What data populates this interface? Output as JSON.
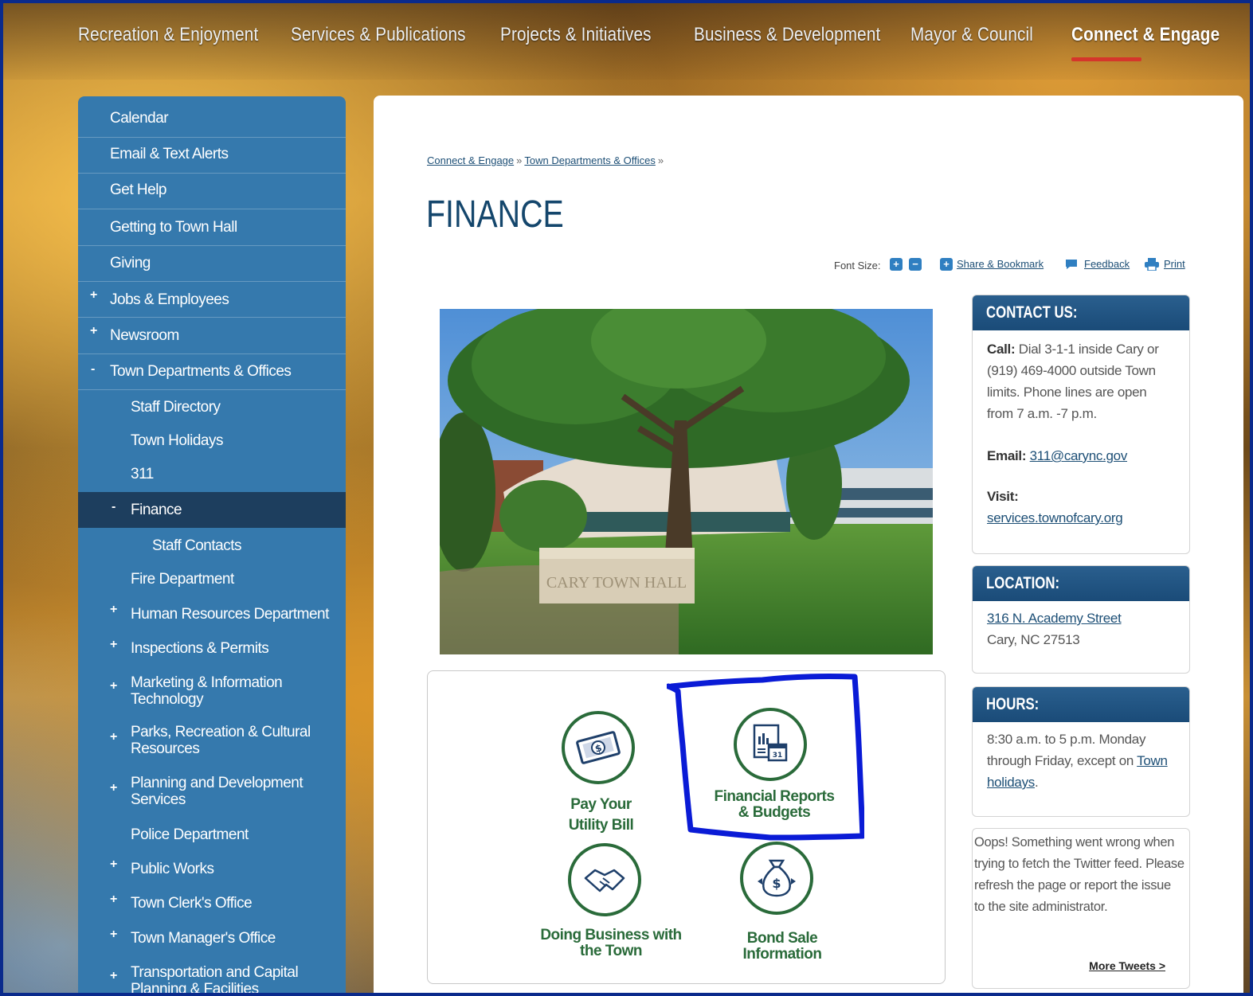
{
  "nav": {
    "items": [
      {
        "label": "Recreation & Enjoyment"
      },
      {
        "label": "Services & Publications"
      },
      {
        "label": "Projects & Initiatives"
      },
      {
        "label": "Business & Development"
      },
      {
        "label": "Mayor & Council"
      },
      {
        "label": "Connect & Engage",
        "active": true
      }
    ],
    "accent": "#d5362b"
  },
  "sidebar": {
    "items": [
      {
        "label": "Calendar"
      },
      {
        "label": "Email & Text Alerts"
      },
      {
        "label": "Get Help"
      },
      {
        "label": "Getting to Town Hall"
      },
      {
        "label": "Giving"
      },
      {
        "label": "Jobs & Employees",
        "marker": "+"
      },
      {
        "label": "Newsroom",
        "marker": "+"
      },
      {
        "label": "Town Departments & Offices",
        "marker": "-"
      },
      {
        "label": "Staff Directory"
      },
      {
        "label": "Town Holidays"
      },
      {
        "label": "311"
      },
      {
        "label": "Finance",
        "marker": "-",
        "active": true
      },
      {
        "label": "Staff Contacts"
      },
      {
        "label": "Fire Department"
      },
      {
        "label": "Human Resources Department",
        "marker": "+"
      },
      {
        "label": "Inspections & Permits",
        "marker": "+"
      },
      {
        "label": "Marketing & Information Technology",
        "marker": "+"
      },
      {
        "label": "Parks, Recreation & Cultural Resources",
        "marker": "+"
      },
      {
        "label": "Planning and Development Services",
        "marker": "+"
      },
      {
        "label": "Police Department"
      },
      {
        "label": "Public Works",
        "marker": "+"
      },
      {
        "label": "Town Clerk's Office",
        "marker": "+"
      },
      {
        "label": "Town Manager's Office",
        "marker": "+"
      },
      {
        "label": "Transportation and Capital Planning & Facilities",
        "marker": "+"
      }
    ]
  },
  "breadcrumb": {
    "items": [
      "Connect & Engage",
      "Town Departments & Offices"
    ],
    "separator": "»"
  },
  "page": {
    "title": "FINANCE"
  },
  "tools": {
    "font_size_label": "Font Size:",
    "increase": "+",
    "decrease": "−",
    "share_icon": "+",
    "share": "Share & Bookmark",
    "feedback": "Feedback",
    "print": "Print"
  },
  "photo": {
    "sign_text": "CARY TOWN HALL"
  },
  "tiles": [
    {
      "label_line1": "Pay Your",
      "label_line2": "Utility Bill",
      "icon": "money-icon"
    },
    {
      "label_line1": "Financial Reports",
      "label_line2": "& Budgets",
      "icon": "report-calendar-icon"
    },
    {
      "label_line1": "Doing Business with",
      "label_line2": "the Town",
      "icon": "handshake-icon"
    },
    {
      "label_line1": "Bond Sale",
      "label_line2": "Information",
      "icon": "money-bag-icon"
    }
  ],
  "contact": {
    "header": "CONTACT US:",
    "call_label": "Call:",
    "call_text": "Dial 3-1-1 inside Cary or (919) 469-4000 outside Town limits. Phone lines are open from 7 a.m. -7 p.m.",
    "email_label": "Email:",
    "email": "311@carync.gov",
    "visit_label": "Visit:",
    "visit": "services.townofcary.org"
  },
  "location": {
    "header": "LOCATION:",
    "street": "316 N. Academy Street",
    "city": "Cary, NC 27513"
  },
  "hours": {
    "header": "HOURS:",
    "text": "8:30 a.m. to 5 p.m. Monday through Friday, except on",
    "link": "Town holidays",
    "end": "."
  },
  "twitter": {
    "message": "Oops! Something went wrong when trying to fetch the Twitter feed. Please refresh the page or report the issue to the site administrator.",
    "more": "More Tweets >"
  },
  "colors": {
    "brand_blue": "#14466c",
    "sidebar": "#3579ad",
    "sidebar_active": "#1d3e5e",
    "tile_green": "#2a6b3a",
    "highlight": "#0a1bd6"
  }
}
